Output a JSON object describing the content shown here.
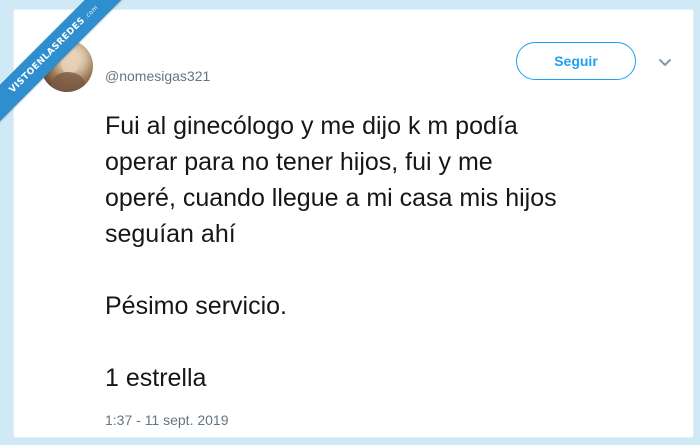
{
  "watermark": {
    "main": "VISTOENLASREDES",
    "sub": ".com"
  },
  "tweet": {
    "username": "@nomesigas321",
    "follow_label": "Seguir",
    "lines": [
      "Fui al ginecólogo y me dijo k m podía",
      "operar para no tener hijos, fui y me",
      "operé, cuando llegue a mi casa mis hijos",
      "seguían ahí",
      "Pésimo servicio.",
      "1 estrella"
    ],
    "timestamp": "1:37 - 11 sept. 2019"
  },
  "colors": {
    "accent": "#1da1f2",
    "text": "#14171a",
    "muted": "#66757f",
    "ribbon": "#2f8fce",
    "frame": "#cfe9f7"
  },
  "icons": {
    "menu": "chevron-down-icon"
  }
}
